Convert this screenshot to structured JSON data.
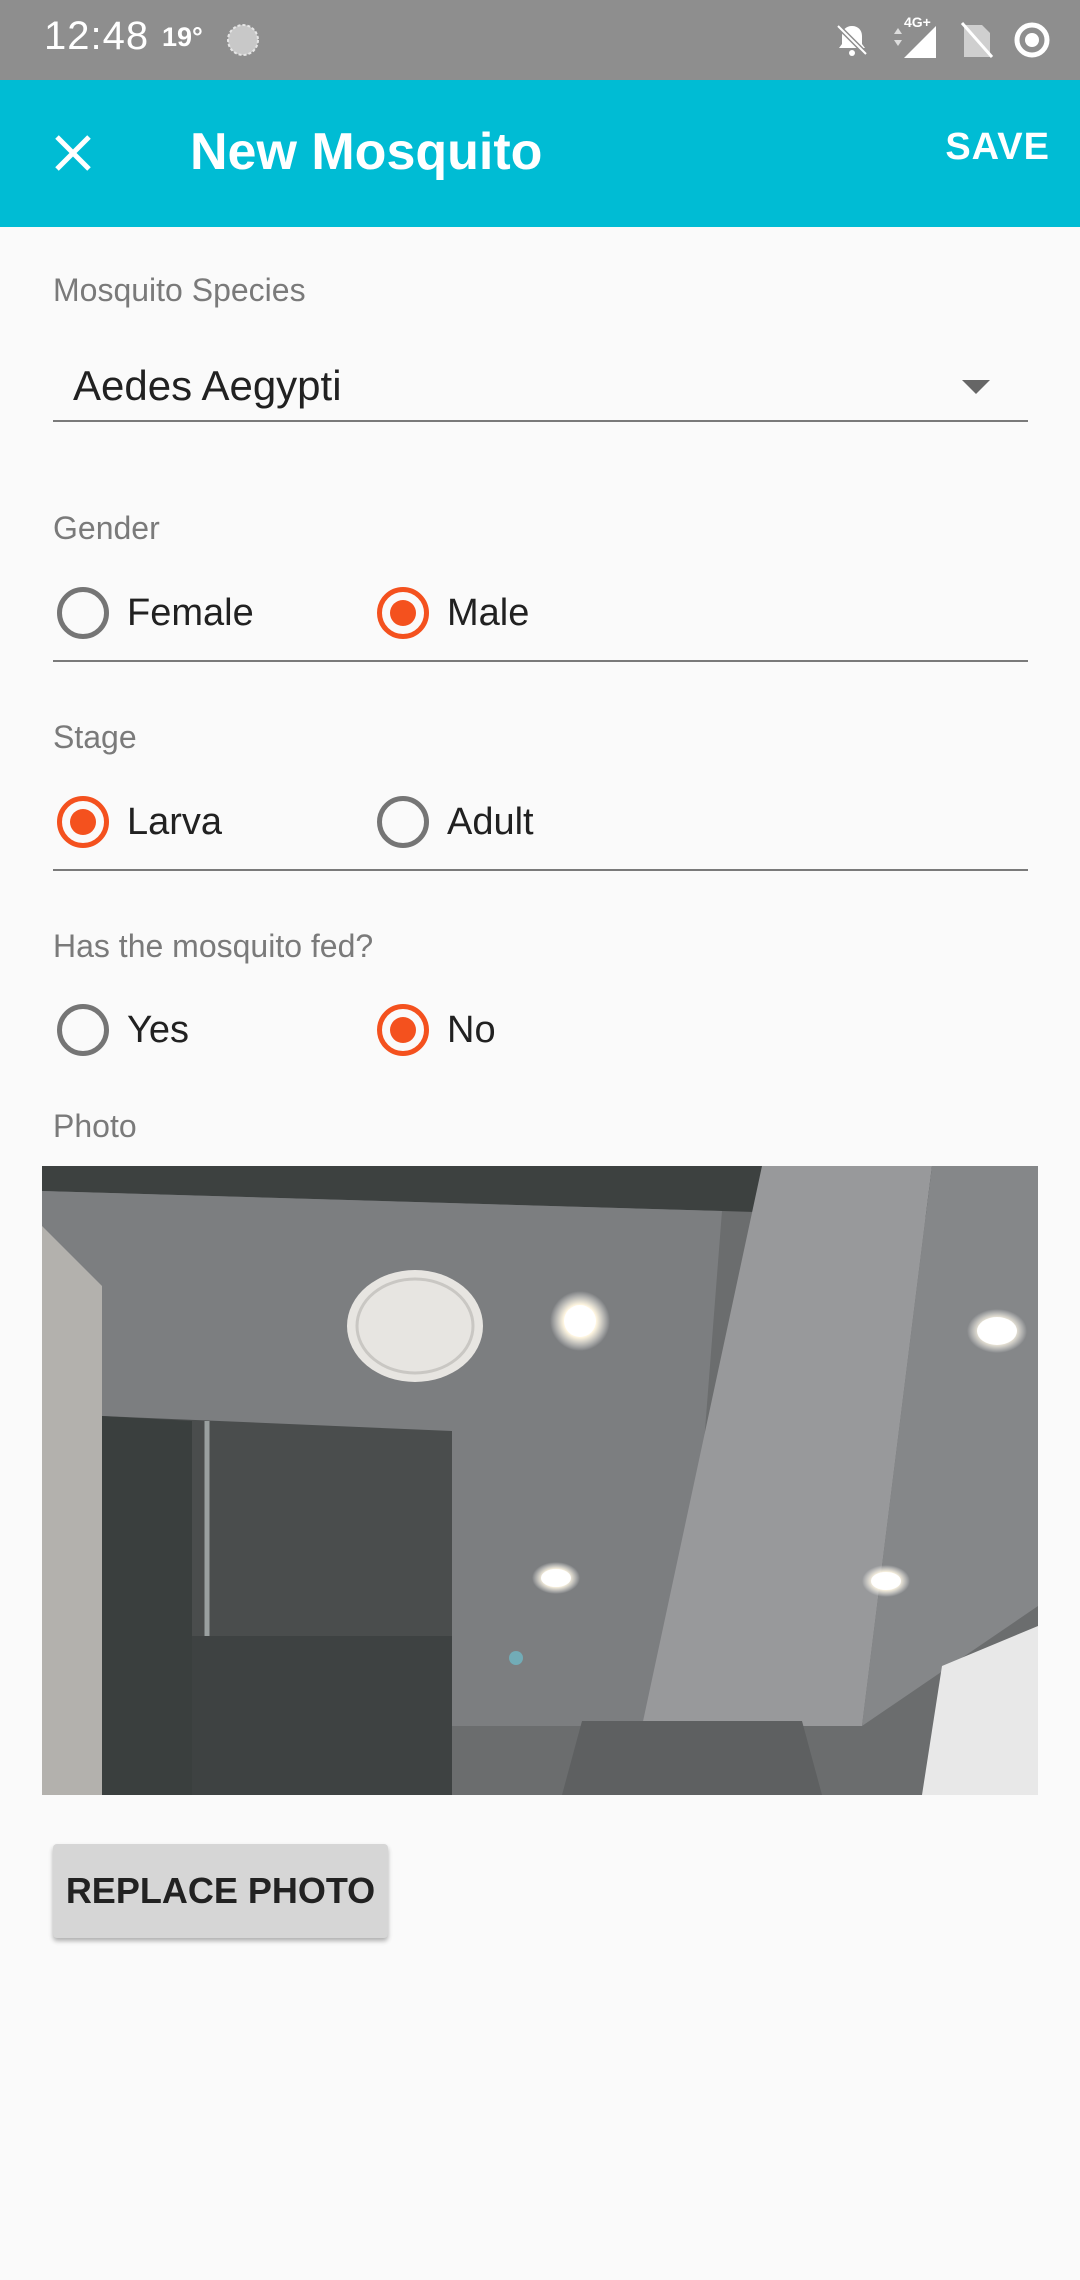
{
  "status_bar": {
    "time": "12:48",
    "temperature": "19°",
    "network": "4G+",
    "icons": [
      "weather-icon",
      "bell-off-icon",
      "signal-icon",
      "no-sim-icon",
      "sync-icon"
    ]
  },
  "app_bar": {
    "title": "New Mosquito",
    "save_label": "SAVE",
    "close_icon": "close-icon",
    "color": "#00bcd4"
  },
  "form": {
    "species": {
      "label": "Mosquito Species",
      "value": "Aedes Aegypti"
    },
    "gender": {
      "label": "Gender",
      "options": [
        {
          "label": "Female",
          "checked": false
        },
        {
          "label": "Male",
          "checked": true
        }
      ]
    },
    "stage": {
      "label": "Stage",
      "options": [
        {
          "label": "Larva",
          "checked": true
        },
        {
          "label": "Adult",
          "checked": false
        }
      ]
    },
    "fed": {
      "label": "Has the mosquito fed?",
      "options": [
        {
          "label": "Yes",
          "checked": false
        },
        {
          "label": "No",
          "checked": true
        }
      ]
    },
    "photo": {
      "label": "Photo",
      "replace_label": "REPLACE PHOTO"
    }
  },
  "colors": {
    "accent": "#f4511e",
    "status_bar": "#8e8e8e"
  }
}
